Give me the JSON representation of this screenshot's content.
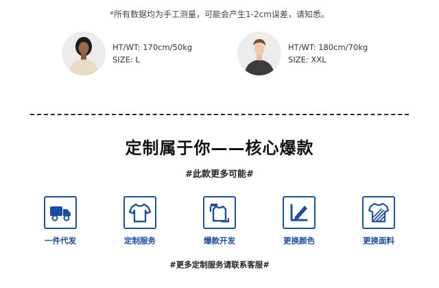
{
  "note": "*所有数据均为手工测量，可能会产生1-2cm误差，请知悉。",
  "models": [
    {
      "ht_wt": "HT/WT: 170cm/50kg",
      "size": "SIZE: L"
    },
    {
      "ht_wt": "HT/WT: 180cm/70kg",
      "size": "SIZE: XXL"
    }
  ],
  "headline": "定制属于你——核心爆款",
  "subhead": "#此款更多可能#",
  "features": [
    {
      "label": "一件代发",
      "icon": "truck-icon"
    },
    {
      "label": "定制服务",
      "icon": "tshirt-icon"
    },
    {
      "label": "爆款开发",
      "icon": "sweater-icon"
    },
    {
      "label": "更换颜色",
      "icon": "color-swatch-icon"
    },
    {
      "label": "更换面料",
      "icon": "fabric-icon"
    }
  ],
  "footer": "#更多定制服务请联系客服#",
  "colors": {
    "accent": "#1a4ea1",
    "text": "#222222",
    "background": "#ffffff"
  }
}
